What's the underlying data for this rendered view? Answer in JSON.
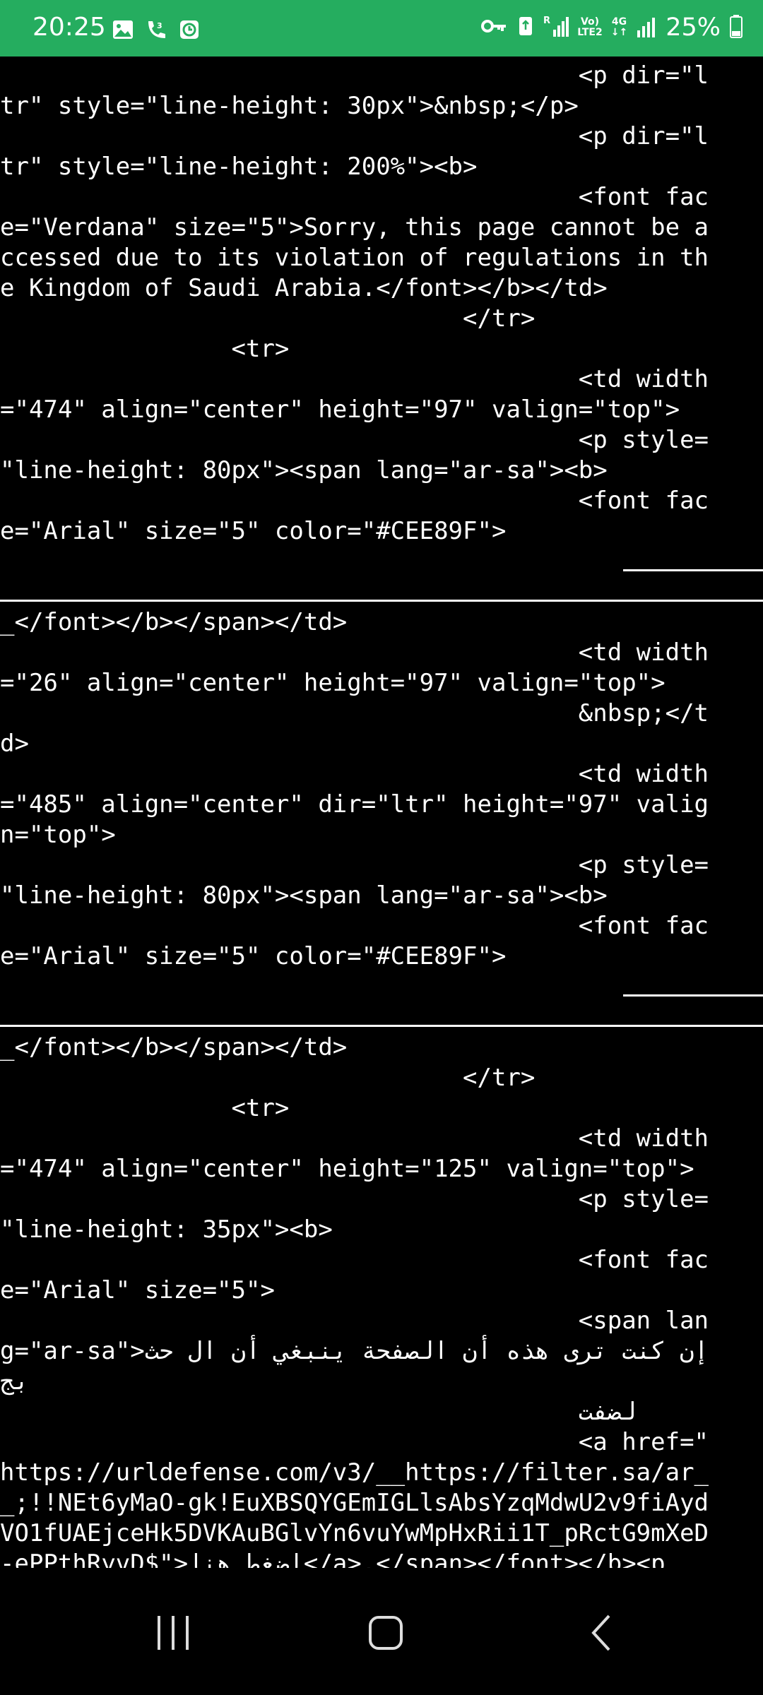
{
  "status_bar": {
    "time": "20:25",
    "battery_percent": "25%",
    "network_label_top": "Vo)",
    "network_label_bottom": "LTE2",
    "network_type": "4G",
    "left_icons": [
      "gallery-icon",
      "missed-call-icon",
      "timer-icon"
    ],
    "right_icons": [
      "vpn-key-icon",
      "recycle-icon",
      "signal-r-icon",
      "volte-icon",
      "4g-icon",
      "signal-icon",
      "battery-icon"
    ]
  },
  "source_lines": [
    "                                        <p dir=\"l",
    "tr\" style=\"line-height: 30px\">&nbsp;</p>",
    "                                        <p dir=\"l",
    "tr\" style=\"line-height: 200%\"><b>",
    "                                        <font fac",
    "e=\"Verdana\" size=\"5\">Sorry, this page cannot be a",
    "ccessed due to its violation of regulations in th",
    "e Kingdom of Saudi Arabia.</font></b></td>",
    "                                </tr>",
    "                <tr>",
    "                                        <td width",
    "=\"474\" align=\"center\" height=\"97\" valign=\"top\">",
    "                                        <p style=",
    "\"line-height: 80px\"><span lang=\"ar-sa\"><b>",
    "                                        <font fac",
    "e=\"Arial\" size=\"5\" color=\"#CEE89F\">",
    "",
    "",
    "_</font></b></span></td>",
    "                                        <td width",
    "=\"26\" align=\"center\" height=\"97\" valign=\"top\">",
    "                                        &nbsp;</t",
    "d>",
    "                                        <td width",
    "=\"485\" align=\"center\" dir=\"ltr\" height=\"97\" valig",
    "n=\"top\">",
    "                                        <p style=",
    "\"line-height: 80px\"><span lang=\"ar-sa\"><b>",
    "                                        <font fac",
    "e=\"Arial\" size=\"5\" color=\"#CEE89F\">",
    "",
    "",
    "_</font></b></span></td>",
    "                                </tr>",
    "                <tr>",
    "                                        <td width",
    "=\"474\" align=\"center\" height=\"125\" valign=\"top\">",
    "                                        <p style=",
    "\"line-height: 35px\"><b>",
    "                                        <font fac",
    "e=\"Arial\" size=\"5\">",
    "                                        <span lan",
    "g=\"ar-sa\">إن كنت ترى هذه أن الصفحة ينبغي أن ال حث",
    "بج",
    "                                        لضفت",
    "                                        <a href=\"",
    "https://urldefense.com/v3/__https://filter.sa/ar_",
    "_;!!NEt6yMaO-gk!EuXBSQYGEmIGLlsAbsYzqMdwU2v9fiAyd",
    "VO1fUAEjceHk5DVKAuBGlvYn6vuYwMpHxRii1T_pRctG9mXeD",
    "-ePPthRyvD$\">اضغط هنا</a>.</span></font></b><p"
  ],
  "navigation": {
    "recents_icon": "recents-icon",
    "home_icon": "home-icon",
    "back_icon": "back-icon"
  }
}
